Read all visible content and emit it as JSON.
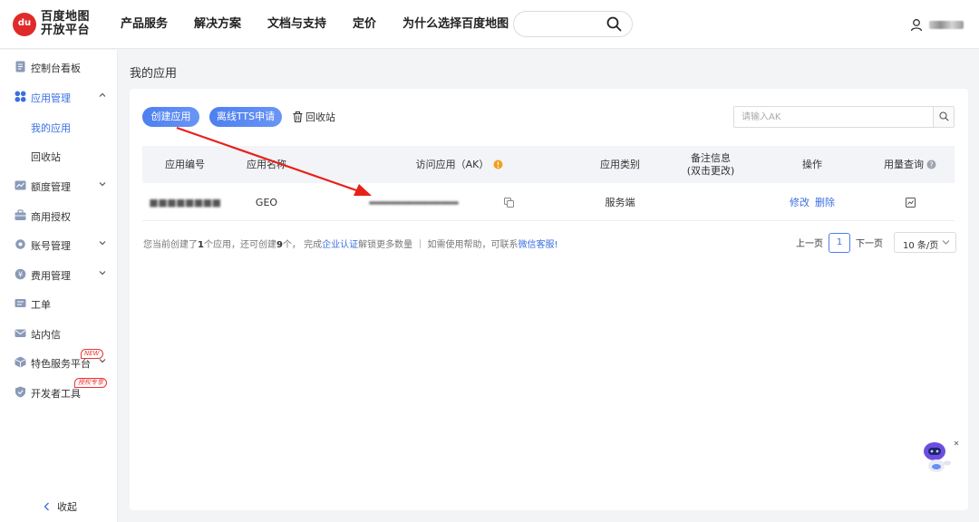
{
  "header": {
    "logo_line1": "百度地图",
    "logo_line2": "开放平台",
    "logo_mark": "du",
    "nav": [
      "产品服务",
      "解决方案",
      "文档与支持",
      "定价",
      "为什么选择百度地图"
    ],
    "search_icon": "search-icon",
    "user_name": "■■■■"
  },
  "sidebar": {
    "items": [
      {
        "label": "控制台看板",
        "icon": "dashboard-icon"
      },
      {
        "label": "应用管理",
        "icon": "apps-icon",
        "expanded": true
      },
      {
        "label": "我的应用",
        "active": true
      },
      {
        "label": "回收站"
      },
      {
        "label": "额度管理",
        "icon": "quota-icon"
      },
      {
        "label": "商用授权",
        "icon": "briefcase-icon"
      },
      {
        "label": "账号管理",
        "icon": "gear-icon"
      },
      {
        "label": "费用管理",
        "icon": "wallet-icon"
      },
      {
        "label": "工单",
        "icon": "ticket-icon"
      },
      {
        "label": "站内信",
        "icon": "mail-icon"
      },
      {
        "label": "特色服务平台",
        "icon": "cube-icon",
        "badge": "NEW"
      },
      {
        "label": "开发者工具",
        "icon": "shield-icon",
        "badge": "授权专享"
      }
    ],
    "collapse_label": "收起"
  },
  "main": {
    "title": "我的应用",
    "create_button": "创建应用",
    "tts_button": "离线TTS申请",
    "recycle_label": "回收站",
    "search_placeholder": "请输入AK",
    "columns": {
      "id": "应用编号",
      "name": "应用名称",
      "ak": "访问应用（AK）",
      "category": "应用类别",
      "note_line1": "备注信息",
      "note_line2": "(双击更改)",
      "ops": "操作",
      "usage": "用量查询"
    },
    "rows": [
      {
        "id": "■■■■■■■■",
        "name": "GEO",
        "ak": "■■■■■■■■■■■■■■■■■■■■■■■■■■■■■■",
        "category": "服务端",
        "note": "",
        "edit": "修改",
        "delete": "删除"
      }
    ],
    "info": {
      "p1": "您当前创建了",
      "created": "1",
      "p2": "个应用，还可创建",
      "remaining": "9",
      "p3": "个，  完成",
      "link1": "企业认证",
      "p4": "解锁更多数量  ｜  如需使用帮助，可联系",
      "link2": "微信客服!"
    },
    "pager": {
      "prev": "上一页",
      "current": "1",
      "next": "下一页",
      "page_size": "10 条/页"
    }
  },
  "colors": {
    "accent": "#4d7ff0",
    "arrow": "#e8201a",
    "background": "#f3f4f6"
  }
}
